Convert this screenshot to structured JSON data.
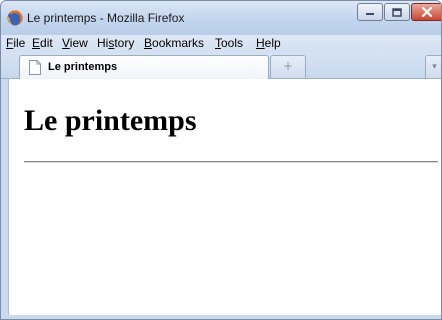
{
  "window": {
    "title": "Le printemps - Mozilla Firefox",
    "app_icon": "firefox-icon",
    "caption_buttons": [
      "minimize-icon",
      "maximize-icon",
      "close-icon"
    ]
  },
  "menubar": {
    "items": [
      {
        "label_u": "F",
        "label_rest": "ile"
      },
      {
        "label_u": "E",
        "label_rest": "dit"
      },
      {
        "label_u": "V",
        "label_rest": "iew"
      },
      {
        "label_pre": "Hi",
        "label_u": "s",
        "label_rest": "tory"
      },
      {
        "label_u": "B",
        "label_rest": "ookmarks"
      },
      {
        "label_u": "T",
        "label_rest": "ools"
      },
      {
        "label_u": "H",
        "label_rest": "elp"
      }
    ]
  },
  "tabs": {
    "active": {
      "label": "Le printemps",
      "icon": "page-icon"
    },
    "new_tab_glyph": "+",
    "list_all_glyph": "▾"
  },
  "page": {
    "heading": "Le printemps"
  },
  "colors": {
    "chrome": "#c9d9ee",
    "close_button": "#c94732",
    "content_bg": "#ffffff",
    "rule": "#8a8a8a"
  }
}
